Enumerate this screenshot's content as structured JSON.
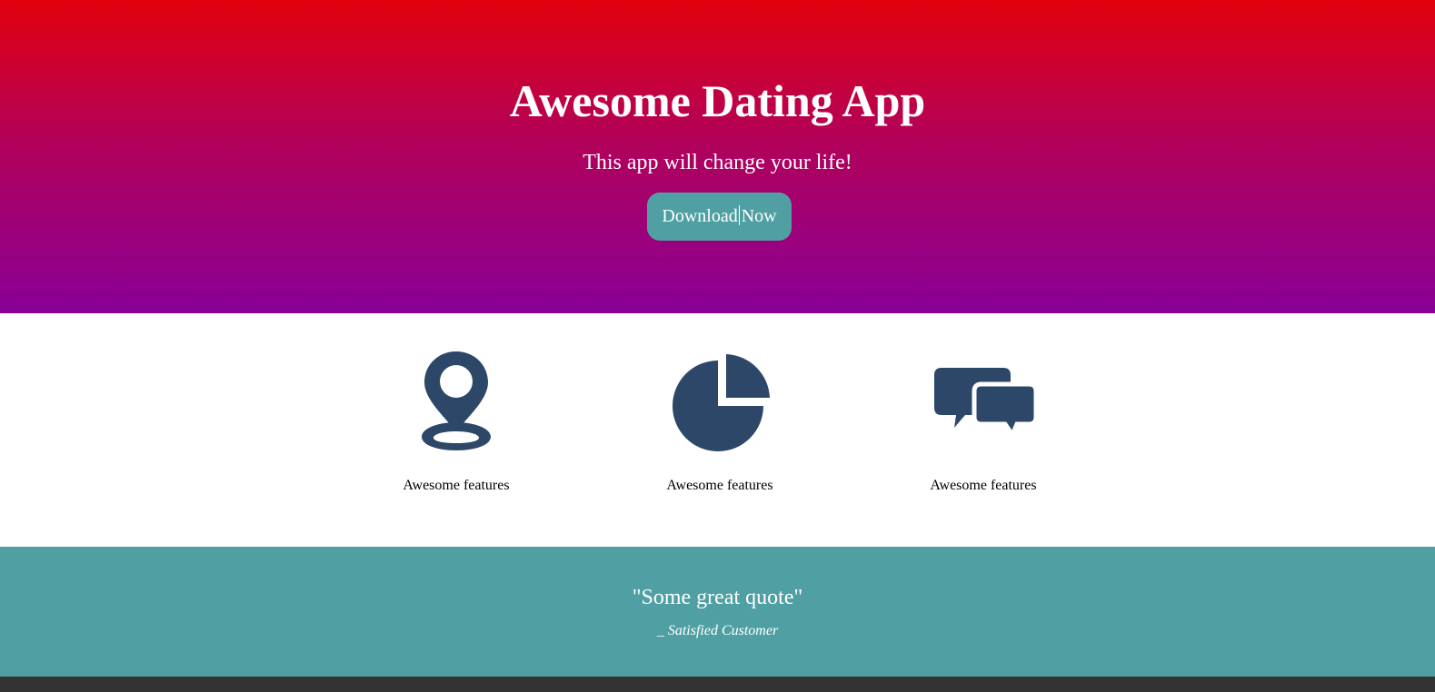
{
  "hero": {
    "title": "Awesome Dating App",
    "subtitle": "This app will change your life!",
    "download_button": {
      "label_before_caret": "Download",
      "label_after_caret": "Now"
    }
  },
  "features": [
    {
      "icon": "map-marker-icon",
      "label": "Awesome features"
    },
    {
      "icon": "pie-chart-icon",
      "label": "Awesome features"
    },
    {
      "icon": "chat-bubbles-icon",
      "label": "Awesome features"
    }
  ],
  "testimonial": {
    "quote": "\"Some great quote\"",
    "author": "_ Satisfied Customer"
  },
  "colors": {
    "hero_gradient_top": "#e2010d",
    "hero_gradient_bottom": "#880096",
    "accent_teal": "#50a0a3",
    "icon_navy": "#2c4768",
    "footer_dark": "#333333"
  }
}
